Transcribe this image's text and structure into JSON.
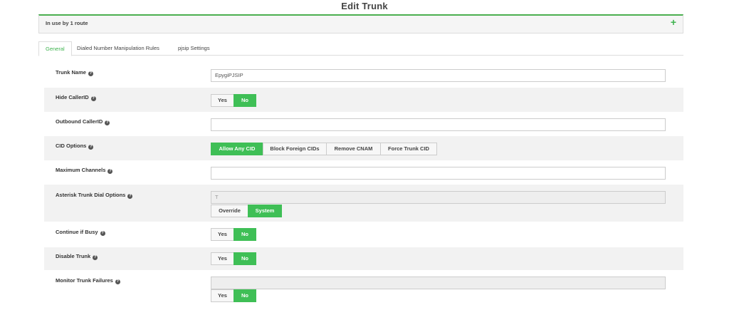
{
  "page": {
    "title": "Edit Trunk"
  },
  "usage": {
    "text": "In use by 1 route",
    "expand_symbol": "+"
  },
  "tabs": [
    {
      "label": "General",
      "active": true
    },
    {
      "label": "Dialed Number Manipulation Rules",
      "active": false
    },
    {
      "label": "pjsip Settings",
      "active": false
    }
  ],
  "form": {
    "trunk_name": {
      "label": "Trunk Name",
      "value": "EpygiPJSIP"
    },
    "hide_callerid": {
      "label": "Hide CallerID",
      "options": [
        "Yes",
        "No"
      ],
      "selected": "No"
    },
    "outbound_callerid": {
      "label": "Outbound CallerID",
      "value": ""
    },
    "cid_options": {
      "label": "CID Options",
      "options": [
        "Allow Any CID",
        "Block Foreign CIDs",
        "Remove CNAM",
        "Force Trunk CID"
      ],
      "selected": "Allow Any CID"
    },
    "max_channels": {
      "label": "Maximum Channels",
      "value": ""
    },
    "dial_options": {
      "label": "Asterisk Trunk Dial Options",
      "value": "T",
      "options": [
        "Override",
        "System"
      ],
      "selected": "System"
    },
    "continue_if_busy": {
      "label": "Continue if Busy",
      "options": [
        "Yes",
        "No"
      ],
      "selected": "No"
    },
    "disable_trunk": {
      "label": "Disable Trunk",
      "options": [
        "Yes",
        "No"
      ],
      "selected": "No"
    },
    "monitor_failures": {
      "label": "Monitor Trunk Failures",
      "value": "",
      "options": [
        "Yes",
        "No"
      ],
      "selected": "No"
    }
  },
  "help_symbol": "?",
  "colors": {
    "accent": "#3fbf56",
    "row_alt": "#f2f2f2"
  }
}
